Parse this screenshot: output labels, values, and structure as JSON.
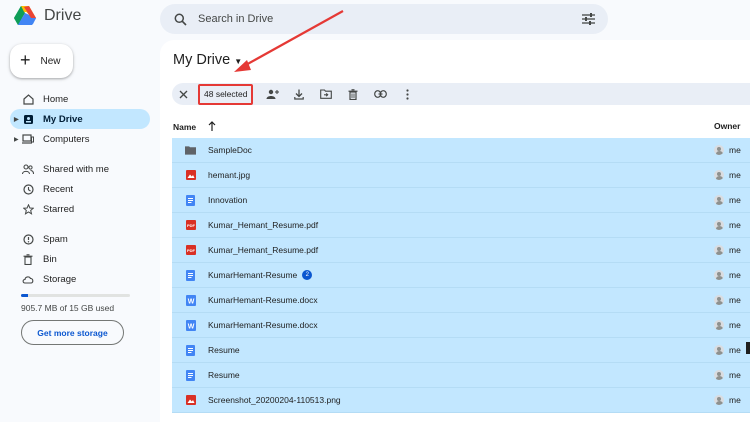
{
  "app": {
    "name": "Drive"
  },
  "search": {
    "placeholder": "Search in Drive",
    "icon": "search-icon",
    "filter_icon": "tune-icon"
  },
  "sidebar": {
    "new_label": "New",
    "items": [
      {
        "label": "Home",
        "icon": "home-icon"
      },
      {
        "label": "My Drive",
        "icon": "my-drive-icon",
        "active": true,
        "expandable": true
      },
      {
        "label": "Computers",
        "icon": "computers-icon",
        "expandable": true
      },
      {
        "label": "Shared with me",
        "icon": "shared-icon"
      },
      {
        "label": "Recent",
        "icon": "clock-icon"
      },
      {
        "label": "Starred",
        "icon": "star-icon"
      },
      {
        "label": "Spam",
        "icon": "spam-icon"
      },
      {
        "label": "Bin",
        "icon": "bin-icon"
      },
      {
        "label": "Storage",
        "icon": "cloud-icon"
      }
    ],
    "storage": {
      "used_text": "905.7 MB of 15 GB used",
      "fraction": 0.06,
      "cta": "Get more storage"
    }
  },
  "main": {
    "title": "My Drive",
    "toolbar": {
      "selected_text": "48 selected",
      "actions": [
        "close-icon",
        "share-icon",
        "download-icon",
        "move-icon",
        "trash-icon",
        "link-icon",
        "more-icon"
      ]
    },
    "columns": {
      "name": "Name",
      "owner": "Owner"
    },
    "files": [
      {
        "name": "SampleDoc",
        "type": "folder",
        "owner": "me"
      },
      {
        "name": "hemant.jpg",
        "type": "image",
        "owner": "me"
      },
      {
        "name": "Innovation",
        "type": "doc",
        "owner": "me"
      },
      {
        "name": "Kumar_Hemant_Resume.pdf",
        "type": "pdf",
        "owner": "me"
      },
      {
        "name": "Kumar_Hemant_Resume.pdf",
        "type": "pdf",
        "owner": "me"
      },
      {
        "name": "KumarHemant-Resume",
        "type": "doc",
        "owner": "me",
        "badge": "2"
      },
      {
        "name": "KumarHemant-Resume.docx",
        "type": "word",
        "owner": "me"
      },
      {
        "name": "KumarHemant-Resume.docx",
        "type": "word",
        "owner": "me"
      },
      {
        "name": "Resume",
        "type": "doc",
        "owner": "me"
      },
      {
        "name": "Resume",
        "type": "doc",
        "owner": "me"
      },
      {
        "name": "Screenshot_20200204-110513.png",
        "type": "image",
        "owner": "me"
      }
    ]
  },
  "colors": {
    "accent": "#0b57d0",
    "selected_row": "#c2e7ff",
    "highlight": "#e53935"
  }
}
